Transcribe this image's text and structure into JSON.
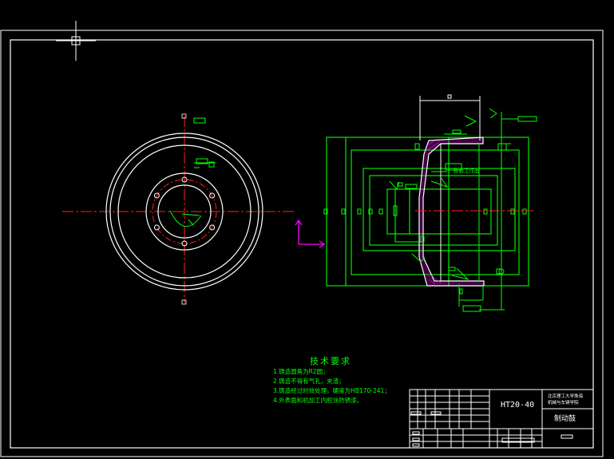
{
  "title_block": {
    "material": "HT20-40",
    "part_name": "制动鼓",
    "institution_line1": "北京理工大学珠海",
    "institution_line2": "机械与车辆学院"
  },
  "technical_requirements": {
    "heading": "技术要求",
    "items": [
      "1.铸造圆角为R2圆；",
      "2.铸造不得有气孔，夹渣；",
      "3.铸造经过时效处理，硬度为HB170-241；",
      "4.外表面和机加工内腔涂防锈漆。"
    ]
  },
  "dimensions": {
    "hub_label": "轮毂工作面",
    "tolerance_frame_text": "0.05 A"
  },
  "colors": {
    "background": "#000000",
    "outline": "#ffffff",
    "geometry": "#00ff00",
    "centerline": "#ff0000",
    "section_hatch": "#ff00ff",
    "ucs": "#ff00ff"
  }
}
